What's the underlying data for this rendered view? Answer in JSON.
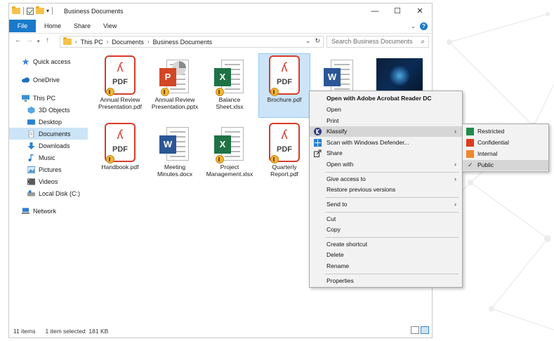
{
  "window": {
    "title": "Business Documents",
    "controls": {
      "minimize": "—",
      "maximize": "☐",
      "close": "✕"
    }
  },
  "ribbon": {
    "tabs": [
      "File",
      "Home",
      "Share",
      "View"
    ],
    "help": "?"
  },
  "addressbar": {
    "crumbs": [
      "This PC",
      "Documents",
      "Business Documents"
    ],
    "search_placeholder": "Search Business Documents"
  },
  "navpane": {
    "items": [
      {
        "label": "Quick access",
        "icon": "star-icon",
        "color": "#3b82d6"
      },
      {
        "label": "OneDrive",
        "icon": "cloud-icon",
        "color": "#1e6fc2"
      },
      {
        "label": "This PC",
        "icon": "computer-icon",
        "color": "#3a8fd6"
      },
      {
        "label": "3D Objects",
        "icon": "cube-icon",
        "color": "#55a7e6"
      },
      {
        "label": "Desktop",
        "icon": "desktop-icon",
        "color": "#2a7fd0"
      },
      {
        "label": "Documents",
        "icon": "documents-icon",
        "color": "#8a8a8a"
      },
      {
        "label": "Downloads",
        "icon": "download-icon",
        "color": "#2a7fd0"
      },
      {
        "label": "Music",
        "icon": "music-icon",
        "color": "#2a7fd0"
      },
      {
        "label": "Pictures",
        "icon": "pictures-icon",
        "color": "#4a90c8"
      },
      {
        "label": "Videos",
        "icon": "videos-icon",
        "color": "#5a5a5a"
      },
      {
        "label": "Local Disk (C:)",
        "icon": "disk-icon",
        "color": "#6a6a6a"
      },
      {
        "label": "Network",
        "icon": "network-icon",
        "color": "#2a7fd0"
      }
    ]
  },
  "files": [
    {
      "name": "Annual Review Presentation.pdf",
      "line1": "Annual Review",
      "line2": "Presentation.pdf",
      "type": "pdf"
    },
    {
      "name": "Annual Review Presentation.pptx",
      "line1": "Annual Review",
      "line2": "Presentation.pptx",
      "type": "pptx",
      "letter": "P"
    },
    {
      "name": "Balance Sheet.xlsx",
      "line1": "Balance",
      "line2": "Sheet.xlsx",
      "type": "xlsx",
      "letter": "X"
    },
    {
      "name": "Brochure.pdf",
      "line1": "Brochure.pdf",
      "line2": "",
      "type": "pdf"
    },
    {
      "name": "",
      "line1": "",
      "line2": "",
      "type": "docx",
      "letter": "W"
    },
    {
      "name": "",
      "line1": "",
      "line2": "",
      "type": "image"
    },
    {
      "name": "Handbook.pdf",
      "line1": "Handbook.pdf",
      "line2": "",
      "type": "pdf"
    },
    {
      "name": "Meeting Minutes.docx",
      "line1": "Meeting",
      "line2": "Minutes.docx",
      "type": "docx",
      "letter": "W"
    },
    {
      "name": "Project Management.xlsx",
      "line1": "Project",
      "line2": "Management.xlsx",
      "type": "xlsx",
      "letter": "X"
    },
    {
      "name": "Quarterly Report.pdf",
      "line1": "Quarterly",
      "line2": "Report.pdf",
      "type": "pdf"
    }
  ],
  "pdf_text": "PDF",
  "context_menu": {
    "open_with_acrobat": "Open with Adobe Acrobat Reader DC",
    "open": "Open",
    "print": "Print",
    "klassify": "Klassify",
    "scan": "Scan with Windows Defender...",
    "share": "Share",
    "open_with": "Open with",
    "give_access": "Give access to",
    "restore": "Restore previous versions",
    "send_to": "Send to",
    "cut": "Cut",
    "copy": "Copy",
    "create_shortcut": "Create shortcut",
    "delete": "Delete",
    "rename": "Rename",
    "properties": "Properties"
  },
  "klassify_submenu": {
    "items": [
      {
        "label": "Restricted",
        "color": "#1f8a4c"
      },
      {
        "label": "Confidential",
        "color": "#e03a1e"
      },
      {
        "label": "Internal",
        "color": "#f0862c"
      },
      {
        "label": "Public",
        "checked": true
      }
    ],
    "tick": "✓"
  },
  "status": {
    "count": "11 items",
    "selection": "1 item selected",
    "size": "181 KB"
  },
  "colors": {
    "accent": "#1979ca",
    "pdf": "#d63b2b",
    "word": "#2b5797",
    "excel": "#1f7244",
    "powerpoint": "#d24726",
    "selection": "#cce4f7"
  }
}
